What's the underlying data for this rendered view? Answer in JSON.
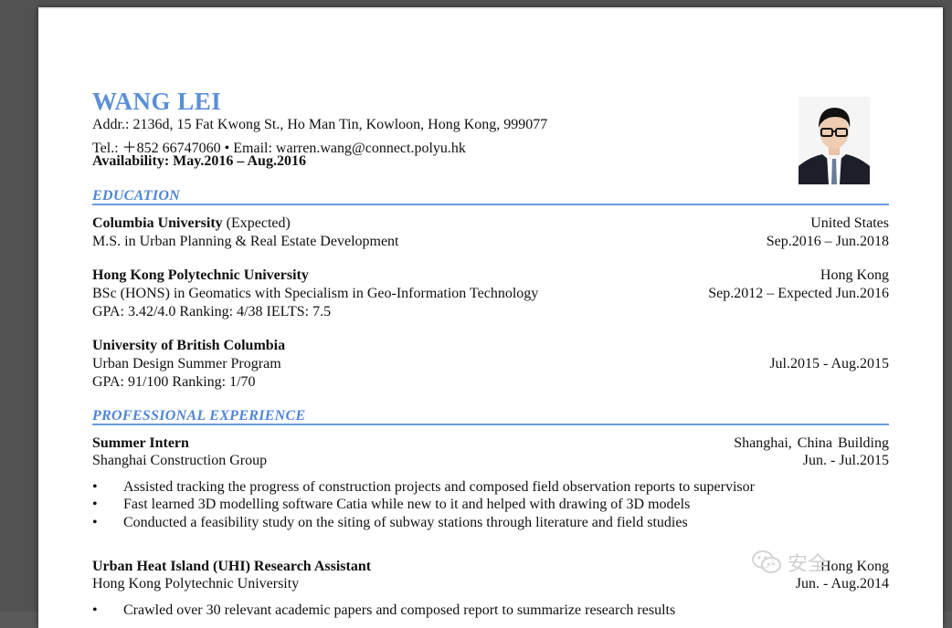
{
  "resume": {
    "name": "WANG LEI",
    "address": "Addr.: 2136d, 15 Fat Kwong St., Ho Man Tin, Kowloon, Hong Kong, 999077",
    "contact": "Tel.: ＋852 66747060 • Email: warren.wang@connect.polyu.hk",
    "availability": "Availability: May.2016 – Aug.2016",
    "photo_icon": "portrait-photo"
  },
  "education": {
    "title": "EDUCATION",
    "entries": [
      {
        "school": "Columbia University",
        "note": " (Expected)",
        "location": "United States",
        "degree": "M.S. in Urban Planning & Real Estate Development",
        "dates": "Sep.2016 – Jun.2018"
      },
      {
        "school": "Hong Kong Polytechnic University",
        "location": "Hong Kong",
        "degree": "BSc (HONS) in Geomatics with Specialism in Geo-Information Technology",
        "dates": "Sep.2012 – Expected Jun.2016",
        "extra": "GPA: 3.42/4.0 Ranking: 4/38 IELTS: 7.5"
      },
      {
        "school": "University of British Columbia",
        "degree": "Urban Design Summer Program",
        "dates": "Jul.2015 - Aug.2015",
        "extra": "GPA: 91/100 Ranking: 1/70"
      }
    ]
  },
  "experience": {
    "title": "PROFESSIONAL EXPERIENCE",
    "entries": [
      {
        "role": "Summer Intern",
        "location": "Shanghai,  China  Building",
        "org": "Shanghai Construction Group",
        "dates": "Jun. - Jul.2015",
        "bullets": [
          "Assisted tracking the progress of construction projects and composed field observation reports to supervisor",
          "Fast learned 3D modelling software Catia while new to it and helped with drawing of 3D models",
          "Conducted a feasibility study on the siting of subway stations through literature and field studies"
        ]
      },
      {
        "role": "Urban Heat Island (UHI) Research Assistant",
        "location": "Hong Kong",
        "org": "Hong Kong Polytechnic University",
        "dates": "Jun. - Aug.2014",
        "bullets": [
          "Crawled over 30 relevant academic papers and composed report to summarize research results"
        ]
      }
    ]
  },
  "bullet_char": "•",
  "watermark": {
    "icon": "wechat-icon",
    "text": "安全"
  },
  "colors": {
    "heading_blue": "#5b8fd6",
    "rule_blue": "#6a9be0",
    "viewer_bg": "#525252"
  }
}
